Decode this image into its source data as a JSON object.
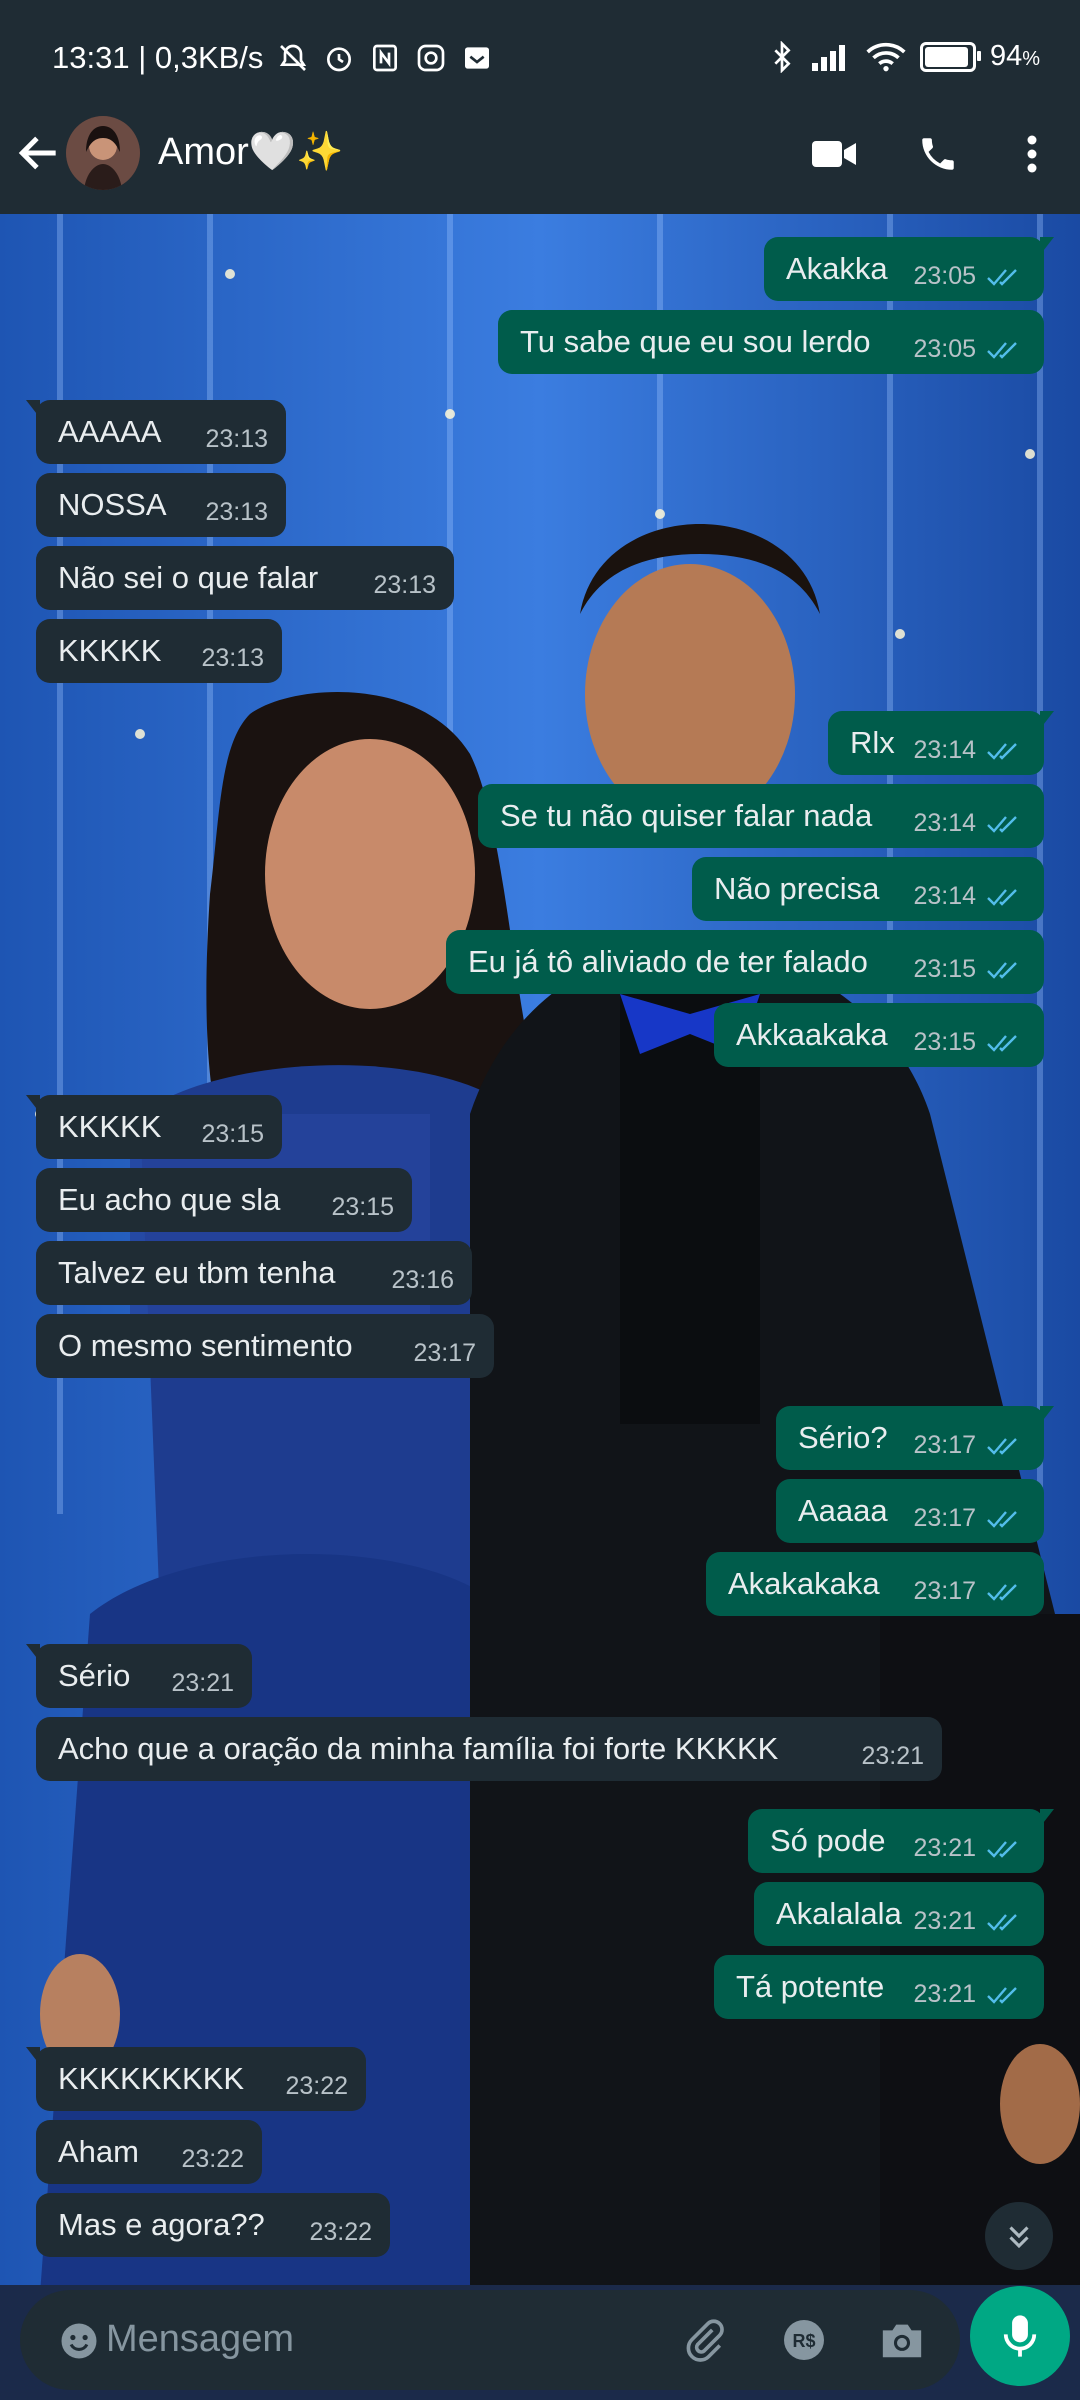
{
  "status_bar": {
    "left_text": "13:31 | 0,3KB/s",
    "battery": "94",
    "battery_unit": "%",
    "battery_level": 0.94
  },
  "header": {
    "contact_name": "Amor🤍✨"
  },
  "messages": [
    {
      "dir": "out",
      "text": "Akakka",
      "time": "23:05",
      "read": true
    },
    {
      "dir": "out",
      "text": "Tu sabe que eu sou lerdo",
      "time": "23:05",
      "read": true
    },
    {
      "dir": "in",
      "text": "AAAAA",
      "time": "23:13"
    },
    {
      "dir": "in",
      "text": "NOSSA",
      "time": "23:13"
    },
    {
      "dir": "in",
      "text": "Não sei o que falar",
      "time": "23:13"
    },
    {
      "dir": "in",
      "text": "KKKKK",
      "time": "23:13"
    },
    {
      "dir": "out",
      "text": "Rlx",
      "time": "23:14",
      "read": true
    },
    {
      "dir": "out",
      "text": "Se tu não quiser falar nada",
      "time": "23:14",
      "read": true
    },
    {
      "dir": "out",
      "text": "Não precisa",
      "time": "23:14",
      "read": true
    },
    {
      "dir": "out",
      "text": "Eu já tô aliviado de ter falado",
      "time": "23:15",
      "read": true
    },
    {
      "dir": "out",
      "text": "Akkaakaka",
      "time": "23:15",
      "read": true
    },
    {
      "dir": "in",
      "text": "KKKKK",
      "time": "23:15"
    },
    {
      "dir": "in",
      "text": "Eu acho que sla",
      "time": "23:15"
    },
    {
      "dir": "in",
      "text": "Talvez eu tbm tenha",
      "time": "23:16"
    },
    {
      "dir": "in",
      "text": "O mesmo sentimento",
      "time": "23:17"
    },
    {
      "dir": "out",
      "text": "Sério?",
      "time": "23:17",
      "read": true
    },
    {
      "dir": "out",
      "text": "Aaaaa",
      "time": "23:17",
      "read": true
    },
    {
      "dir": "out",
      "text": "Akakakaka",
      "time": "23:17",
      "read": true
    },
    {
      "dir": "in",
      "text": "Sério",
      "time": "23:21"
    },
    {
      "dir": "in",
      "text": "Acho que a oração da minha família foi forte KKKKK",
      "time": "23:21"
    },
    {
      "dir": "out",
      "text": "Só pode",
      "time": "23:21",
      "read": true
    },
    {
      "dir": "out",
      "text": "Akalalala",
      "time": "23:21",
      "read": true
    },
    {
      "dir": "out",
      "text": "Tá potente",
      "time": "23:21",
      "read": true
    },
    {
      "dir": "in",
      "text": "KKKKKKKKK",
      "time": "23:22"
    },
    {
      "dir": "in",
      "text": "Aham",
      "time": "23:22"
    },
    {
      "dir": "in",
      "text": "Mas e agora??",
      "time": "23:22"
    }
  ],
  "input": {
    "placeholder": "Mensagem"
  },
  "colors": {
    "incoming_bubble": "#1f2c34",
    "outgoing_bubble": "#005c4b",
    "read_tick": "#53bdeb",
    "accent": "#00a884"
  },
  "icons": {
    "status": [
      "mute-icon",
      "alarm-icon",
      "nfc-icon",
      "instagram-icon",
      "inbox-icon",
      "bluetooth-icon",
      "signal-icon",
      "wifi-icon",
      "battery-icon"
    ],
    "header": [
      "back-arrow-icon",
      "video-call-icon",
      "voice-call-icon",
      "more-options-icon"
    ],
    "input": [
      "emoji-icon",
      "attach-icon",
      "payment-icon",
      "camera-icon",
      "mic-icon"
    ]
  }
}
